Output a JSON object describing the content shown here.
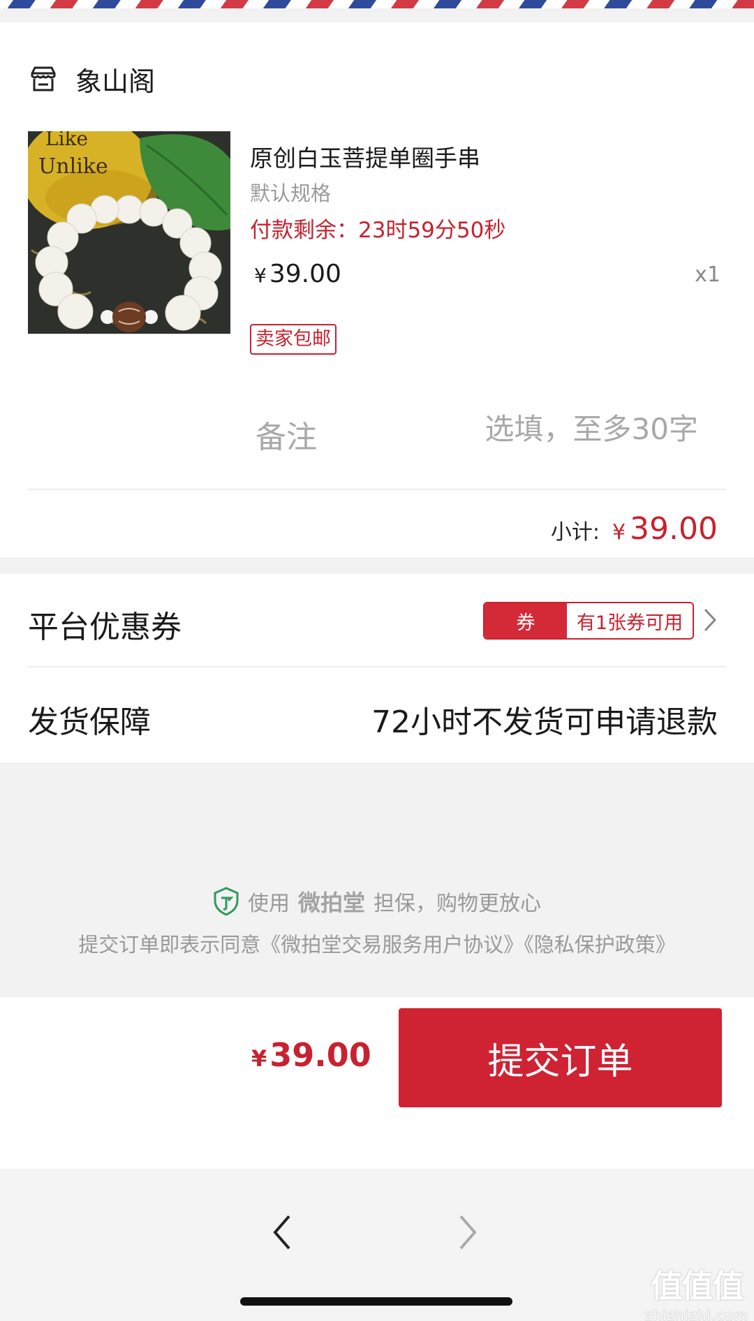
{
  "shop": {
    "name": "象山阁",
    "icon": "store-icon"
  },
  "product": {
    "title": "原创白玉菩提单圈手串",
    "spec": "默认规格",
    "pay_remaining": "付款剩余：23时59分50秒",
    "price_symbol": "¥",
    "price": "39.00",
    "quantity": "x1",
    "shipping_tag": "卖家包邮",
    "image_text": [
      "Like",
      "Unlike"
    ]
  },
  "remark": {
    "label": "备注",
    "placeholder": "选填，至多30字"
  },
  "subtotal": {
    "label": "小计:",
    "symbol": "¥",
    "value": "39.00"
  },
  "coupon": {
    "label": "平台优惠券",
    "badge_left": "券",
    "badge_right": "有1张券可用"
  },
  "delivery": {
    "label": "发货保障",
    "value": "72小时不发货可申请退款"
  },
  "footer": {
    "use_text": "使用",
    "brand": "微拍堂",
    "guarantee_text": "担保，购物更放心",
    "agreement": "提交订单即表示同意《微拍堂交易服务用户协议》《隐私保护政策》"
  },
  "checkout": {
    "symbol": "¥",
    "total": "39.00",
    "submit_label": "提交订单"
  },
  "watermark": {
    "logo": "值值值",
    "url": "zhizhizhi.com"
  },
  "colors": {
    "accent": "#cf2233",
    "price_red": "#c8212f",
    "muted": "#999999"
  }
}
